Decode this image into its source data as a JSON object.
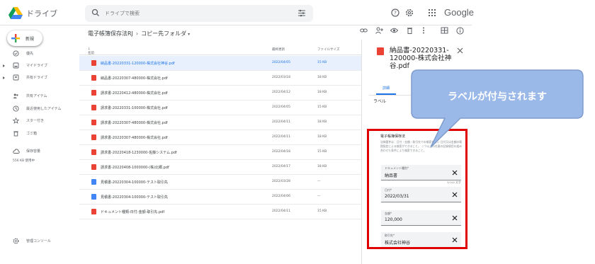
{
  "header": {
    "app_name": "ドライブ",
    "search_placeholder": "ドライブで検索",
    "brand": "Google"
  },
  "sidebar": {
    "new_label": "新規",
    "items": [
      {
        "label": "優先",
        "icon": "check-circle-icon"
      },
      {
        "label": "マイドライブ",
        "icon": "my-drive-icon"
      },
      {
        "label": "共有ドライブ",
        "icon": "shared-drive-icon"
      },
      {
        "label": "共有アイテム",
        "icon": "people-icon"
      },
      {
        "label": "最近使用したアイテム",
        "icon": "clock-icon"
      },
      {
        "label": "スター付き",
        "icon": "star-icon"
      },
      {
        "label": "ゴミ箱",
        "icon": "trash-icon"
      },
      {
        "label": "保存容量",
        "icon": "cloud-icon"
      }
    ],
    "storage_used": "556 KB 使用中",
    "admin_console": "管理コンソール"
  },
  "main": {
    "breadcrumb": [
      "電子帳簿保存法RJ",
      "コピー先フォルダ"
    ],
    "columns": {
      "name": "名前",
      "modified": "最終更新",
      "size": "ファイルサイズ"
    },
    "rows": [
      {
        "name": "納品書-20220331-120000-株式会社神谷.pdf",
        "date": "2022/04/05",
        "size": "15 KB",
        "type": "pdf",
        "selected": true
      },
      {
        "name": "納品書-20220307-480000-株式会社.pdf",
        "date": "2022/03/18",
        "size": "18 KB",
        "type": "pdf"
      },
      {
        "name": "請求書-20220412-480000-株式会社.pdf",
        "date": "2022/04/12",
        "size": "18 KB",
        "type": "pdf"
      },
      {
        "name": "請求書-20220331-100000-株式会社.pdf",
        "date": "2022/04/05",
        "size": "15 KB",
        "type": "pdf"
      },
      {
        "name": "請求書-20220307-480000-株式会社.pdf",
        "date": "2022/04/11",
        "size": "18 KB",
        "type": "pdf"
      },
      {
        "name": "請求書-20220307-480000-株式会社.pdf",
        "date": "2022/04/11",
        "size": "18 KB",
        "type": "pdf"
      },
      {
        "name": "請求書-20220418-1230000-佐藤システム.pdf",
        "date": "2022/04/18",
        "size": "15 KB",
        "type": "pdf"
      },
      {
        "name": "請求書-20220408-1000000-(株)北郷.pdf",
        "date": "2022/04/17",
        "size": "18 KB",
        "type": "pdf"
      },
      {
        "name": "見積書-20220304-100000-テスト取引先",
        "date": "2022/03/28",
        "size": "—",
        "type": "doc"
      },
      {
        "name": "見積書-20220304-100000-テスト取引先",
        "date": "2022/04/06",
        "size": "—",
        "type": "doc"
      },
      {
        "name": "ドキュメント種類-日付-金額-取引先.pdf",
        "date": "2022/04/11",
        "size": "15 KB",
        "type": "pdf"
      }
    ]
  },
  "panel": {
    "title": "納品書-20220331-120000-株式会社神谷.pdf",
    "tab_details": "詳細",
    "labels_heading": "ラベル",
    "label_group": "電子帳簿保存法",
    "label_description": "法律要件は、日付・金額・取引先での検索を行い 日付又は金額の範囲指定による検索ができること。 二つ以上の任意の記録項目を組み合わせた条件により検索できること。",
    "fields": [
      {
        "label": "ドキュメント種別*",
        "value": "納品書"
      },
      {
        "label": "日付*",
        "value": "2022/03/31"
      },
      {
        "label": "金額*",
        "value": "120,000"
      },
      {
        "label": "取引先*",
        "value": "株式会社神谷"
      }
    ],
    "counter": "3/100 文字"
  },
  "callout": {
    "text": "ラベルが付与されます"
  },
  "colors": {
    "accent": "#1a73e8",
    "highlight_border": "#e10000",
    "callout_fill": "#9ab8e8",
    "pdf_red": "#ea4335"
  }
}
